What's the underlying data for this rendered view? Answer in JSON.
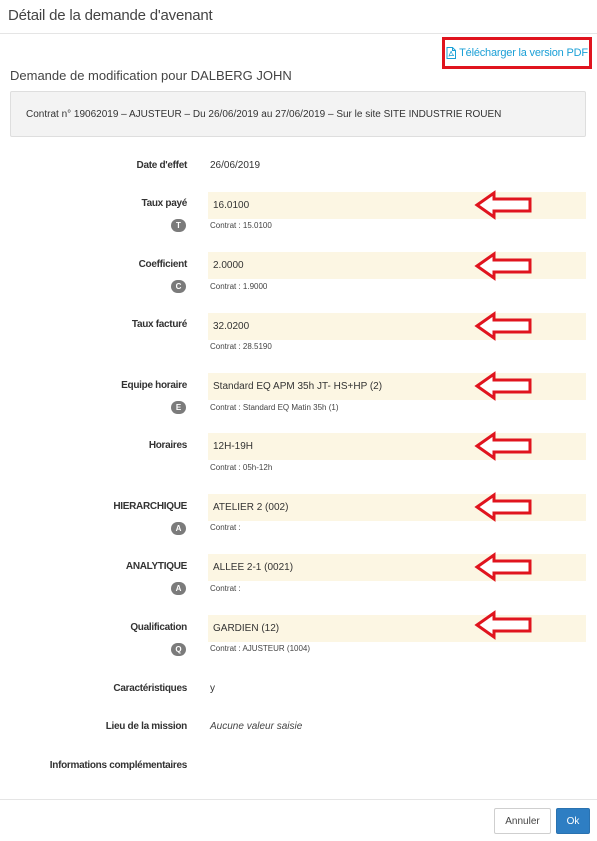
{
  "modal": {
    "title": "Détail de la demande d'avenant",
    "pdf_link": "Télécharger la version PDF",
    "subtitle": "Demande de modification pour DALBERG JOHN",
    "contract_summary": "Contrat n° 19062019  – AJUSTEUR  – Du 26/06/2019 au 27/06/2019  – Sur le site SITE INDUSTRIE ROUEN"
  },
  "fields": {
    "date_effet": {
      "label": "Date d'effet",
      "value": "26/06/2019"
    },
    "taux_paye": {
      "label": "Taux payé",
      "badge": "T",
      "value": "16.0100",
      "contract": "Contrat : 15.0100"
    },
    "coefficient": {
      "label": "Coefficient",
      "badge": "C",
      "value": "2.0000",
      "contract": "Contrat : 1.9000"
    },
    "taux_facture": {
      "label": "Taux facturé",
      "value": "32.0200",
      "contract": "Contrat : 28.5190"
    },
    "equipe_horaire": {
      "label": "Equipe horaire",
      "badge": "E",
      "value": "Standard EQ APM 35h JT- HS+HP (2)",
      "contract": "Contrat : Standard EQ Matin 35h (1)"
    },
    "horaires": {
      "label": "Horaires",
      "value": "12H-19H",
      "contract": "Contrat : 05h-12h"
    },
    "hierarchique": {
      "label": "HIERARCHIQUE",
      "badge": "A",
      "value": "ATELIER 2 (002)",
      "contract": "Contrat :"
    },
    "analytique": {
      "label": "ANALYTIQUE",
      "badge": "A",
      "value": "ALLEE 2-1 (0021)",
      "contract": "Contrat :"
    },
    "qualification": {
      "label": "Qualification",
      "badge": "Q",
      "value": "GARDIEN (12)",
      "contract": "Contrat : AJUSTEUR (1004)"
    },
    "caracteristiques": {
      "label": "Caractéristiques",
      "value": "y"
    },
    "lieu_mission": {
      "label": "Lieu de la mission",
      "value": "Aucune valeur saisie"
    },
    "infos_complementaires": {
      "label": "Informations complémentaires",
      "value": ""
    }
  },
  "buttons": {
    "cancel": "Annuler",
    "ok": "Ok"
  },
  "colors": {
    "annotation_red": "#e0141e",
    "highlight_field": "#fcf6e3",
    "link": "#1a9fd6",
    "primary_button": "#2e7ec3"
  },
  "icons": {
    "pdf": "pdf-file-icon",
    "arrow": "left-arrow-annotation-icon"
  }
}
